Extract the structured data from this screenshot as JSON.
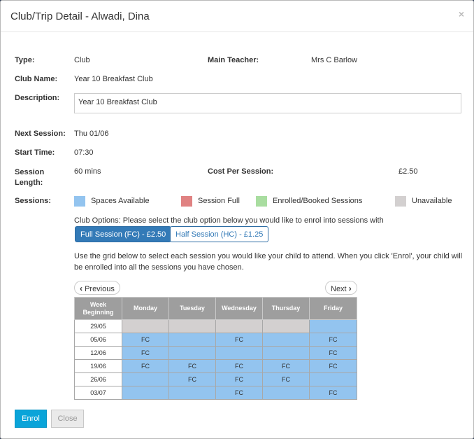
{
  "modal": {
    "title": "Club/Trip Detail - Alwadi, Dina",
    "close_glyph": "×"
  },
  "fields": {
    "type_label": "Type:",
    "type_value": "Club",
    "teacher_label": "Main Teacher:",
    "teacher_value": "Mrs C Barlow",
    "club_name_label": "Club Name:",
    "club_name_value": "Year 10 Breakfast Club",
    "description_label": "Description:",
    "description_value": "Year 10 Breakfast Club",
    "next_session_label": "Next Session:",
    "next_session_value": "Thu 01/06",
    "start_time_label": "Start Time:",
    "start_time_value": "07:30",
    "session_length_label": "Session Length:",
    "session_length_value": "60 mins",
    "cost_label": "Cost Per Session:",
    "cost_value": "£2.50",
    "sessions_label": "Sessions:"
  },
  "legend": [
    {
      "label": "Spaces Available",
      "color": "#93c4ef"
    },
    {
      "label": "Session Full",
      "color": "#e08282"
    },
    {
      "label": "Enrolled/Booked Sessions",
      "color": "#a9dda0"
    },
    {
      "label": "Unavailable",
      "color": "#d3d0d0"
    }
  ],
  "club_options": {
    "prompt": "Club Options: Please select the club option below you would like to enrol into sessions with",
    "full_session": "Full Session (FC) - £2.50",
    "half_session": "Half Session (HC) - £1.25",
    "selected": "full_session"
  },
  "instructions": "Use the grid below to select each session you would like your child to attend. When you click 'Enrol', your child will be enrolled into all the sessions you have chosen.",
  "pager": {
    "previous": "Previous",
    "next": "Next"
  },
  "grid": {
    "headers": [
      "Week Beginning",
      "Monday",
      "Tuesday",
      "Wednesday",
      "Thursday",
      "Friday"
    ],
    "rows": [
      {
        "week": "29/05",
        "cells": [
          {
            "s": "u",
            "t": ""
          },
          {
            "s": "u",
            "t": ""
          },
          {
            "s": "u",
            "t": ""
          },
          {
            "s": "u",
            "t": ""
          },
          {
            "s": "a",
            "t": ""
          }
        ]
      },
      {
        "week": "05/06",
        "cells": [
          {
            "s": "a",
            "t": "FC"
          },
          {
            "s": "a",
            "t": ""
          },
          {
            "s": "a",
            "t": "FC"
          },
          {
            "s": "a",
            "t": ""
          },
          {
            "s": "a",
            "t": "FC"
          }
        ]
      },
      {
        "week": "12/06",
        "cells": [
          {
            "s": "a",
            "t": "FC"
          },
          {
            "s": "a",
            "t": ""
          },
          {
            "s": "a",
            "t": ""
          },
          {
            "s": "a",
            "t": ""
          },
          {
            "s": "a",
            "t": "FC"
          }
        ]
      },
      {
        "week": "19/06",
        "cells": [
          {
            "s": "a",
            "t": "FC"
          },
          {
            "s": "a",
            "t": "FC"
          },
          {
            "s": "a",
            "t": "FC"
          },
          {
            "s": "a",
            "t": "FC"
          },
          {
            "s": "a",
            "t": "FC"
          }
        ]
      },
      {
        "week": "26/06",
        "cells": [
          {
            "s": "a",
            "t": ""
          },
          {
            "s": "a",
            "t": "FC"
          },
          {
            "s": "a",
            "t": "FC"
          },
          {
            "s": "a",
            "t": "FC"
          },
          {
            "s": "a",
            "t": ""
          }
        ]
      },
      {
        "week": "03/07",
        "cells": [
          {
            "s": "a",
            "t": ""
          },
          {
            "s": "a",
            "t": ""
          },
          {
            "s": "a",
            "t": "FC"
          },
          {
            "s": "a",
            "t": ""
          },
          {
            "s": "a",
            "t": "FC"
          }
        ]
      }
    ]
  },
  "footer": {
    "enrol": "Enrol",
    "close": "Close"
  }
}
